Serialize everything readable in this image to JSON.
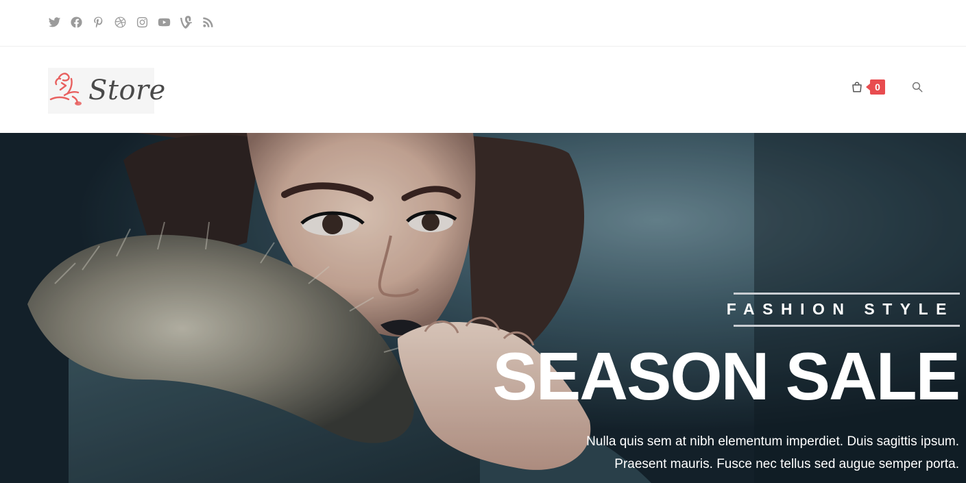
{
  "social": [
    {
      "icon": "twitter-icon"
    },
    {
      "icon": "facebook-icon"
    },
    {
      "icon": "pinterest-icon"
    },
    {
      "icon": "dribbble-icon"
    },
    {
      "icon": "instagram-icon"
    },
    {
      "icon": "youtube-icon"
    },
    {
      "icon": "vine-icon"
    },
    {
      "icon": "rss-icon"
    }
  ],
  "header": {
    "logo_text": "Store",
    "cart_count": "0",
    "cart_icon": "shopping-bag-icon",
    "search_icon": "search-icon"
  },
  "hero": {
    "kicker": "FASHION STYLE",
    "title": "SEASON SALE",
    "description_line1": "Nulla quis sem at nibh elementum imperdiet. Duis sagittis ipsum.",
    "description_line2": "Praesent mauris. Fusce nec tellus sed augue semper porta."
  },
  "colors": {
    "accent": "#e84c4f",
    "icon_gray": "#9b9b9b",
    "hero_text": "#ffffff"
  }
}
